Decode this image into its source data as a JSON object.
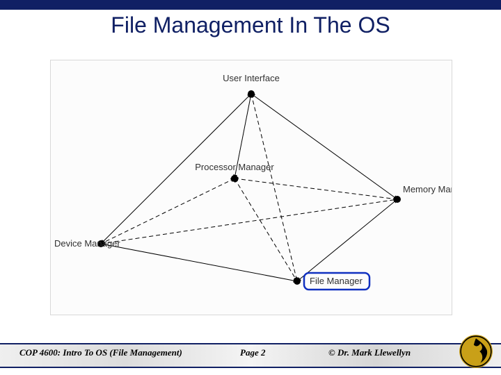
{
  "title": "File Management In The OS",
  "diagram": {
    "nodes": {
      "ui": {
        "label": "User Interface"
      },
      "processor": {
        "label": "Processor Manager"
      },
      "memory": {
        "label": "Memory Manager"
      },
      "device": {
        "label": "Device Manager"
      },
      "file": {
        "label": "File Manager"
      }
    },
    "highlighted_node": "file",
    "solid_edges_desc": "outer-perimeter (ui-memory-file-device-ui) plus ui-processor",
    "dashed_edges_desc": "processor-memory, processor-device, processor-file, ui-file, device-memory"
  },
  "footer": {
    "course": "COP 4600: Intro To OS  (File Management)",
    "page": "Page 2",
    "author": "© Dr. Mark Llewellyn"
  },
  "brand": {
    "name": "UCF",
    "color": "#c9a018"
  }
}
